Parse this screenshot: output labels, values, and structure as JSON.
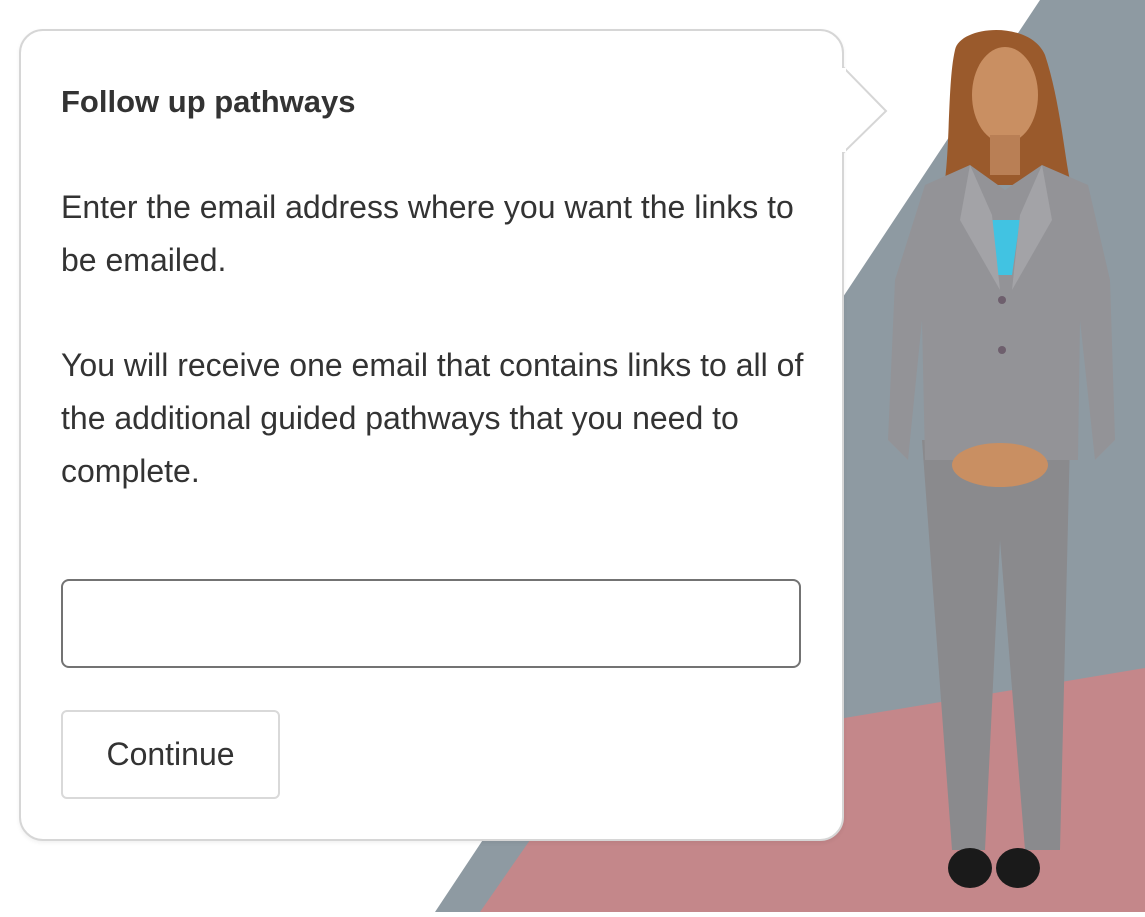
{
  "dialog": {
    "title": "Follow up pathways",
    "paragraph_1": "Enter the email address where you want the links to be emailed.",
    "paragraph_2": "You will receive one email that contains links to all of the additional guided pathways that you need to complete.",
    "email_input": {
      "value": "",
      "placeholder": ""
    },
    "continue_label": "Continue"
  },
  "colors": {
    "background_grey": "#8e9aa2",
    "background_pink": "#c4878a",
    "text": "#333333",
    "input_border": "#737373",
    "button_border": "#d9d9d9",
    "suit": "#8f8f92",
    "blouse": "#41c3e2",
    "skin": "#c98f62",
    "hair": "#9a5a2c"
  },
  "icons": {
    "avatar": "presenter-woman-illustration"
  }
}
